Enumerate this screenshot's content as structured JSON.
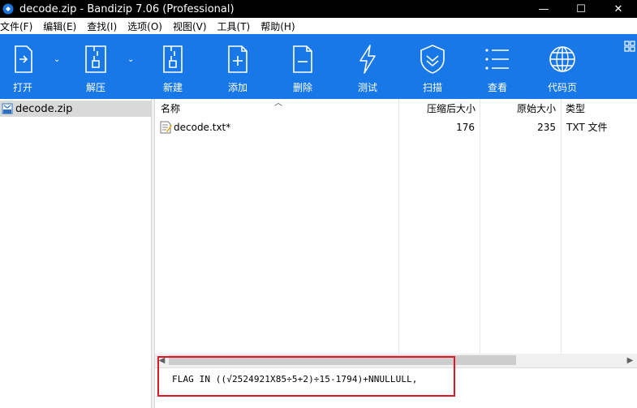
{
  "window": {
    "title": "decode.zip - Bandizip 7.06 (Professional)",
    "controls": {
      "minimize": "—",
      "maximize": "☐",
      "close": "✕"
    }
  },
  "menubar": [
    "文件(F)",
    "编辑(E)",
    "查找(I)",
    "选项(O)",
    "视图(V)",
    "工具(T)",
    "帮助(H)"
  ],
  "toolbar": {
    "buttons": [
      {
        "label": "打开",
        "icon": "open-archive-icon"
      },
      {
        "label": "解压",
        "icon": "extract-icon"
      },
      {
        "label": "新建",
        "icon": "new-archive-icon"
      },
      {
        "label": "添加",
        "icon": "add-file-icon"
      },
      {
        "label": "删除",
        "icon": "delete-file-icon"
      },
      {
        "label": "测试",
        "icon": "test-lightning-icon"
      },
      {
        "label": "扫描",
        "icon": "scan-shield-icon"
      },
      {
        "label": "查看",
        "icon": "view-list-icon"
      },
      {
        "label": "代码页",
        "icon": "codepage-globe-icon"
      }
    ],
    "background": "#1878e8"
  },
  "tree": {
    "archive": "decode.zip"
  },
  "list": {
    "columns": [
      "名称",
      "压缩后大小",
      "原始大小",
      "类型"
    ],
    "rows": [
      {
        "name": "decode.txt*",
        "compressed": "176",
        "original": "235",
        "type": "TXT 文件"
      }
    ]
  },
  "comment": {
    "text": "FLAG IN ((√2524921X85÷5+2)÷15-1794)+NNULLULL,"
  },
  "colors": {
    "highlight": "#e0162a"
  }
}
